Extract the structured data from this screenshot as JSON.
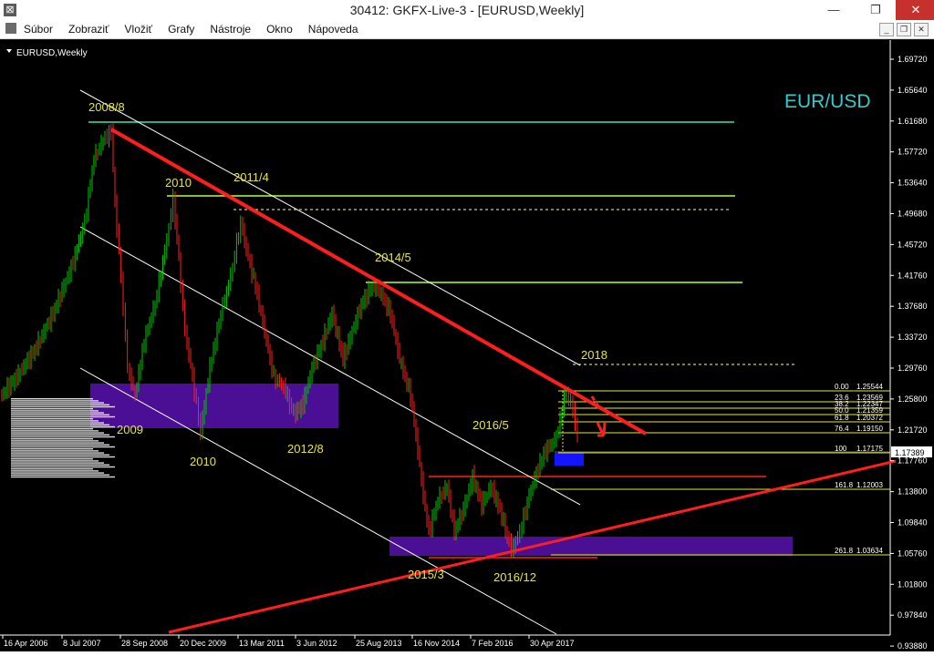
{
  "window": {
    "title": "30412: GKFX-Live-3 - [EURUSD,Weekly]",
    "minimize_label": "—",
    "maximize_label": "❐",
    "close_label": "✕"
  },
  "menu": [
    "Súbor",
    "Zobraziť",
    "Vložiť",
    "Grafy",
    "Nástroje",
    "Okno",
    "Nápoveda"
  ],
  "mdi_buttons": [
    "_",
    "❐",
    "✕"
  ],
  "chart": {
    "symbol_label": "EURUSD,Weekly",
    "watermark": "EUR/USD",
    "price_tag": "1.17389",
    "y_ticks": [
      "1.69720",
      "1.65640",
      "1.61680",
      "1.57720",
      "1.53640",
      "1.49680",
      "1.45720",
      "1.41760",
      "1.37680",
      "1.33720",
      "1.29760",
      "1.25800",
      "1.21720",
      "1.17760",
      "1.13800",
      "1.09840",
      "1.05760",
      "1.01800",
      "0.97840",
      "0.93880"
    ],
    "x_ticks": [
      "16 Apr 2006",
      "8 Jul 2007",
      "28 Sep 2008",
      "20 Dec 2009",
      "13 Mar 2011",
      "3 Jun 2012",
      "25 Aug 2013",
      "16 Nov 2014",
      "7 Feb 2016",
      "30 Apr 2017"
    ],
    "annotations": [
      "2008/8",
      "2010",
      "2011/4",
      "2014/5",
      "2018",
      "2016/5",
      "2009",
      "2010",
      "2012/8",
      "2015/3",
      "2016/12"
    ],
    "fib_levels": [
      {
        "level": "0.00",
        "price": "1.25544"
      },
      {
        "level": "23.6",
        "price": "1.23569"
      },
      {
        "level": "38.2",
        "price": "1.22347"
      },
      {
        "level": "50.0",
        "price": "1.21359"
      },
      {
        "level": "61.8",
        "price": "1.20372"
      },
      {
        "level": "76.4",
        "price": "1.19150"
      },
      {
        "level": "100",
        "price": "1.17175"
      },
      {
        "level": "161.8",
        "price": "1.12003"
      },
      {
        "level": "261.8",
        "price": "1.03634"
      }
    ],
    "colors": {
      "bull": "#00c800",
      "bear": "#ff2020",
      "trend": "#ff1e1e",
      "zone": "#4b0f96",
      "fib": "#e6e632",
      "hline_green": "#9be600",
      "hline_teal": "#33e6b4",
      "watermark": "#33cccc"
    }
  }
}
